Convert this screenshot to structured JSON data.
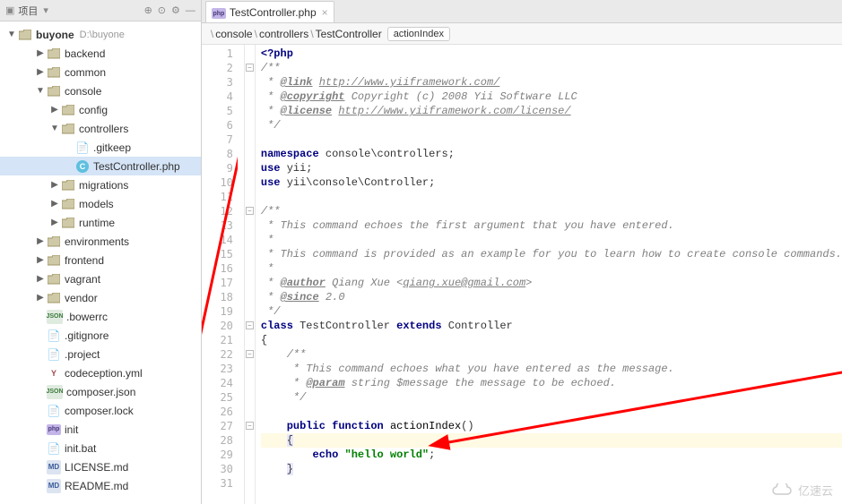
{
  "sidebar": {
    "title": "项目",
    "project_name": "buyone",
    "project_path": "D:\\buyone",
    "tree": [
      {
        "label": "backend",
        "indent": 2,
        "arrow": "▶",
        "type": "folder"
      },
      {
        "label": "common",
        "indent": 2,
        "arrow": "▶",
        "type": "folder"
      },
      {
        "label": "console",
        "indent": 2,
        "arrow": "▼",
        "type": "folder"
      },
      {
        "label": "config",
        "indent": 3,
        "arrow": "▶",
        "type": "folder"
      },
      {
        "label": "controllers",
        "indent": 3,
        "arrow": "▼",
        "type": "folder"
      },
      {
        "label": ".gitkeep",
        "indent": 4,
        "arrow": "",
        "type": "file-txt"
      },
      {
        "label": "TestController.php",
        "indent": 4,
        "arrow": "",
        "type": "file-class",
        "selected": true
      },
      {
        "label": "migrations",
        "indent": 3,
        "arrow": "▶",
        "type": "folder"
      },
      {
        "label": "models",
        "indent": 3,
        "arrow": "▶",
        "type": "folder"
      },
      {
        "label": "runtime",
        "indent": 3,
        "arrow": "▶",
        "type": "folder"
      },
      {
        "label": "environments",
        "indent": 2,
        "arrow": "▶",
        "type": "folder"
      },
      {
        "label": "frontend",
        "indent": 2,
        "arrow": "▶",
        "type": "folder"
      },
      {
        "label": "vagrant",
        "indent": 2,
        "arrow": "▶",
        "type": "folder"
      },
      {
        "label": "vendor",
        "indent": 2,
        "arrow": "▶",
        "type": "folder"
      },
      {
        "label": ".bowerrc",
        "indent": 2,
        "arrow": "",
        "type": "file-json"
      },
      {
        "label": ".gitignore",
        "indent": 2,
        "arrow": "",
        "type": "file-txt"
      },
      {
        "label": ".project",
        "indent": 2,
        "arrow": "",
        "type": "file-txt"
      },
      {
        "label": "codeception.yml",
        "indent": 2,
        "arrow": "",
        "type": "file-y"
      },
      {
        "label": "composer.json",
        "indent": 2,
        "arrow": "",
        "type": "file-json"
      },
      {
        "label": "composer.lock",
        "indent": 2,
        "arrow": "",
        "type": "file-txt"
      },
      {
        "label": "init",
        "indent": 2,
        "arrow": "",
        "type": "file-php"
      },
      {
        "label": "init.bat",
        "indent": 2,
        "arrow": "",
        "type": "file-txt"
      },
      {
        "label": "LICENSE.md",
        "indent": 2,
        "arrow": "",
        "type": "file-md"
      },
      {
        "label": "README.md",
        "indent": 2,
        "arrow": "",
        "type": "file-md"
      }
    ]
  },
  "tab": {
    "filename": "TestController.php"
  },
  "breadcrumb": {
    "parts": [
      "console",
      "controllers",
      "TestController"
    ],
    "method": "actionIndex"
  },
  "code_lines": [
    {
      "n": 1,
      "html": "<span class='c-kw'>&lt;?php</span>"
    },
    {
      "n": 2,
      "html": "<span class='c-cm'>/**</span>"
    },
    {
      "n": 3,
      "html": "<span class='c-cm'> * <span class='c-doc'>@link</span> <span class='c-lnk'>http://www.yiiframework.com/</span></span>"
    },
    {
      "n": 4,
      "html": "<span class='c-cm'> * <span class='c-doc'>@copyright</span> Copyright (c) 2008 Yii Software LLC</span>"
    },
    {
      "n": 5,
      "html": "<span class='c-cm'> * <span class='c-doc'>@license</span> <span class='c-lnk'>http://www.yiiframework.com/license/</span></span>"
    },
    {
      "n": 6,
      "html": "<span class='c-cm'> */</span>"
    },
    {
      "n": 7,
      "html": ""
    },
    {
      "n": 8,
      "html": "<span class='c-kw'>namespace</span> console\\controllers;"
    },
    {
      "n": 9,
      "html": "<span class='c-kw'>use</span> yii;"
    },
    {
      "n": 10,
      "html": "<span class='c-kw'>use</span> yii\\console\\Controller;"
    },
    {
      "n": 11,
      "html": ""
    },
    {
      "n": 12,
      "html": "<span class='c-cm'>/**</span>"
    },
    {
      "n": 13,
      "html": "<span class='c-cm'> * This command echoes the first argument that you have entered.</span>"
    },
    {
      "n": 14,
      "html": "<span class='c-cm'> *</span>"
    },
    {
      "n": 15,
      "html": "<span class='c-cm'> * This command is provided as an example for you to learn how to create console commands.</span>"
    },
    {
      "n": 16,
      "html": "<span class='c-cm'> *</span>"
    },
    {
      "n": 17,
      "html": "<span class='c-cm'> * <span class='c-doc'>@author</span> Qiang Xue &lt;<span class='c-lnk'>qiang.xue@gmail.com</span>&gt;</span>"
    },
    {
      "n": 18,
      "html": "<span class='c-cm'> * <span class='c-doc'>@since</span> 2.0</span>"
    },
    {
      "n": 19,
      "html": "<span class='c-cm'> */</span>"
    },
    {
      "n": 20,
      "html": "<span class='c-kw'>class</span> TestController <span class='c-kw'>extends</span> Controller"
    },
    {
      "n": 21,
      "html": "{"
    },
    {
      "n": 22,
      "html": "    <span class='c-cm'>/**</span>"
    },
    {
      "n": 23,
      "html": "    <span class='c-cm'> * This command echoes what you have entered as the message.</span>"
    },
    {
      "n": 24,
      "html": "    <span class='c-cm'> * <span class='c-doc'>@param</span> string $message the message to be echoed.</span>"
    },
    {
      "n": 25,
      "html": "    <span class='c-cm'> */</span>"
    },
    {
      "n": 26,
      "html": ""
    },
    {
      "n": 27,
      "html": "    <span class='c-kw'>public function</span> <span class='c-fn'>actionIndex</span>()"
    },
    {
      "n": 28,
      "html": "    <span style='background:#e7e7ff;'>{</span>",
      "hl": true
    },
    {
      "n": 29,
      "html": "        <span class='c-kw'>echo</span> <span class='c-str'>\"hello world\"</span>;"
    },
    {
      "n": 30,
      "html": "    <span style='background:#e7e7ff;'>}</span>"
    },
    {
      "n": 31,
      "html": ""
    }
  ],
  "watermark": "亿速云"
}
